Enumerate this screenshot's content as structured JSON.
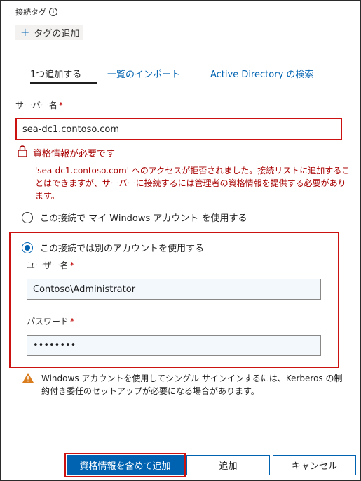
{
  "tags": {
    "label": "接続タグ",
    "info_icon": "info-icon",
    "add_button": "タグの追加"
  },
  "tabs": [
    {
      "label": "1つ追加する",
      "active": true
    },
    {
      "label": "一覧のインポート",
      "active": false
    },
    {
      "label": "Active Directory の検索",
      "active": false
    }
  ],
  "server": {
    "label": "サーバー名",
    "required_mark": "*",
    "value": "sea-dc1.contoso.com"
  },
  "error": {
    "icon": "lock-icon",
    "title": "資格情報が必要です",
    "message": "'sea-dc1.contoso.com' へのアクセスが拒否されました。接続リストに追加することはできますが、サーバーに接続するには管理者の資格情報を提供する必要があります。"
  },
  "auth": {
    "option_windows": "この接続で マイ Windows アカウント を使用する",
    "option_other": "この接続では別のアカウントを使用する",
    "selected": "other",
    "username_label": "ユーザー名",
    "username_value": "Contoso\\Administrator",
    "password_label": "パスワード",
    "password_value": "••••••••",
    "required_mark": "*"
  },
  "warning": {
    "icon": "warning-icon",
    "text": "Windows アカウントを使用してシングル サインインするには、Kerberos の制約付き委任のセットアップが必要になる場合があります。"
  },
  "buttons": {
    "add_with_credentials": "資格情報を含めて追加",
    "add": "追加",
    "cancel": "キャンセル"
  },
  "colors": {
    "accent": "#0063b1",
    "error": "#a80000",
    "highlight_border": "#cc1111",
    "warning": "#d97d1f"
  }
}
